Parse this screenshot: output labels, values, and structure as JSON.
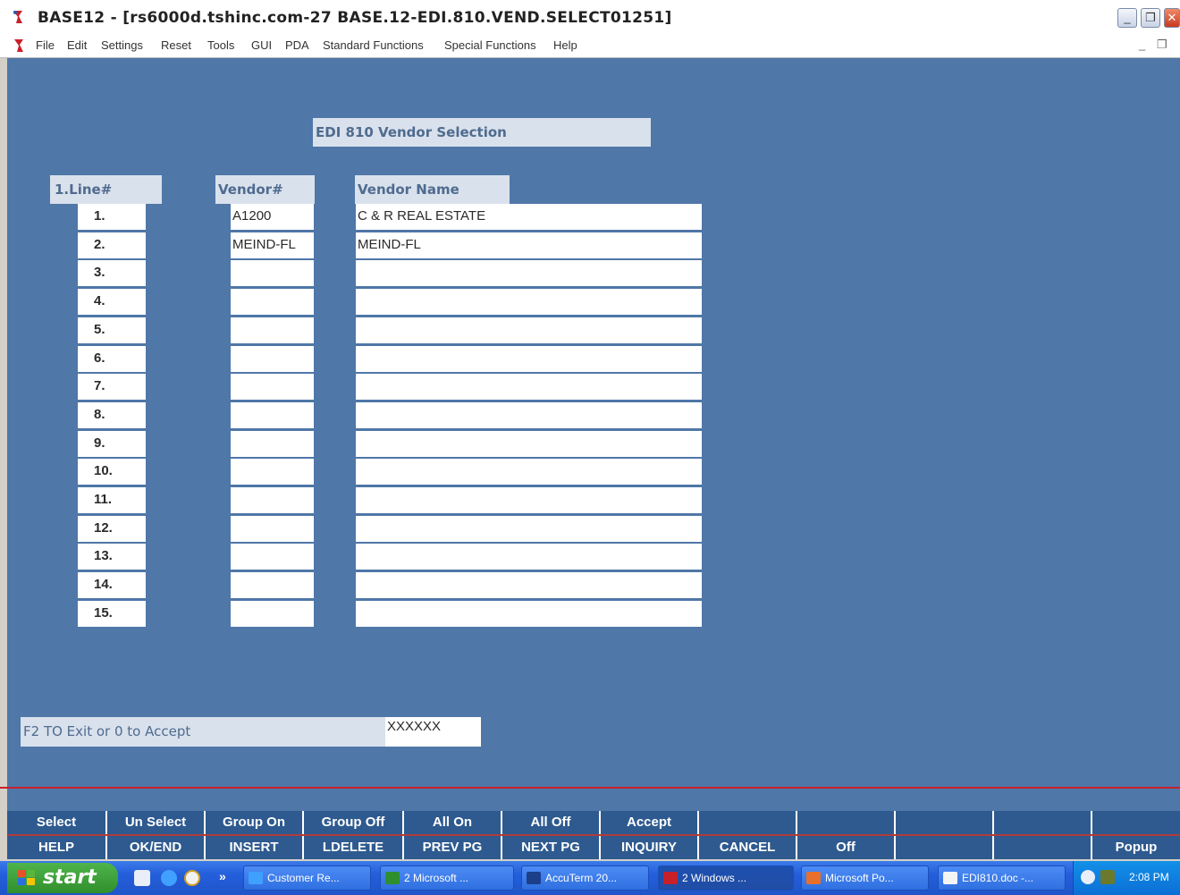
{
  "window": {
    "title": "BASE12 - [rs6000d.tshinc.com-27 BASE.12-EDI.810.VEND.SELECT01251]",
    "controls": {
      "minimize": "_",
      "restore": "❐",
      "close": "✕"
    }
  },
  "menu": {
    "items": [
      "File",
      "Edit",
      "Settings",
      "Reset",
      "Tools",
      "GUI",
      "PDA",
      "Standard Functions",
      "Special Functions",
      "Help"
    ],
    "right_controls": {
      "minimize": "_",
      "restore": "❐"
    }
  },
  "screen": {
    "heading": "EDI 810 Vendor Selection",
    "columns": {
      "line": "1.Line#",
      "vendor": "Vendor#",
      "vendor_name": "Vendor Name"
    },
    "rows": [
      {
        "line": "1.",
        "vendor": "A1200",
        "name": "C & R REAL ESTATE"
      },
      {
        "line": "2.",
        "vendor": "MEIND-FL",
        "name": "MEIND-FL"
      },
      {
        "line": "3.",
        "vendor": "",
        "name": ""
      },
      {
        "line": "4.",
        "vendor": "",
        "name": ""
      },
      {
        "line": "5.",
        "vendor": "",
        "name": ""
      },
      {
        "line": "6.",
        "vendor": "",
        "name": ""
      },
      {
        "line": "7.",
        "vendor": "",
        "name": ""
      },
      {
        "line": "8.",
        "vendor": "",
        "name": ""
      },
      {
        "line": "9.",
        "vendor": "",
        "name": ""
      },
      {
        "line": "10.",
        "vendor": "",
        "name": ""
      },
      {
        "line": "11.",
        "vendor": "",
        "name": ""
      },
      {
        "line": "12.",
        "vendor": "",
        "name": ""
      },
      {
        "line": "13.",
        "vendor": "",
        "name": ""
      },
      {
        "line": "14.",
        "vendor": "",
        "name": ""
      },
      {
        "line": "15.",
        "vendor": "",
        "name": ""
      }
    ],
    "prompt": {
      "label": "F2 TO Exit or 0 to Accept",
      "value": "XXXXXX"
    }
  },
  "function_keys": {
    "top": [
      "Select",
      "Un Select",
      "Group On",
      "Group Off",
      "All On",
      "All Off",
      "Accept",
      "",
      "",
      "",
      "",
      ""
    ],
    "bottom": [
      "HELP",
      "OK/END",
      "INSERT",
      "LDELETE",
      "PREV PG",
      "NEXT PG",
      "INQUIRY",
      "CANCEL",
      "Off",
      "",
      "",
      "Popup"
    ]
  },
  "taskbar": {
    "start_label": "start",
    "quicklaunch_more": "»",
    "tasks": [
      {
        "label": "Customer Re...",
        "icon": "ie-icon"
      },
      {
        "label": "2 Microsoft ...",
        "icon": "excel-icon"
      },
      {
        "label": "AccuTerm 20...",
        "icon": "accuterm-icon"
      },
      {
        "label": "2 Windows ...",
        "icon": "windows-icon"
      },
      {
        "label": "Microsoft Po...",
        "icon": "powerpoint-icon"
      },
      {
        "label": "EDI810.doc -...",
        "icon": "word-icon"
      }
    ],
    "clock": "2:08 PM"
  },
  "colors": {
    "screen_bg": "#4f77a8",
    "function_bar": "#2e5a8f",
    "accent_red": "#c8202a"
  }
}
